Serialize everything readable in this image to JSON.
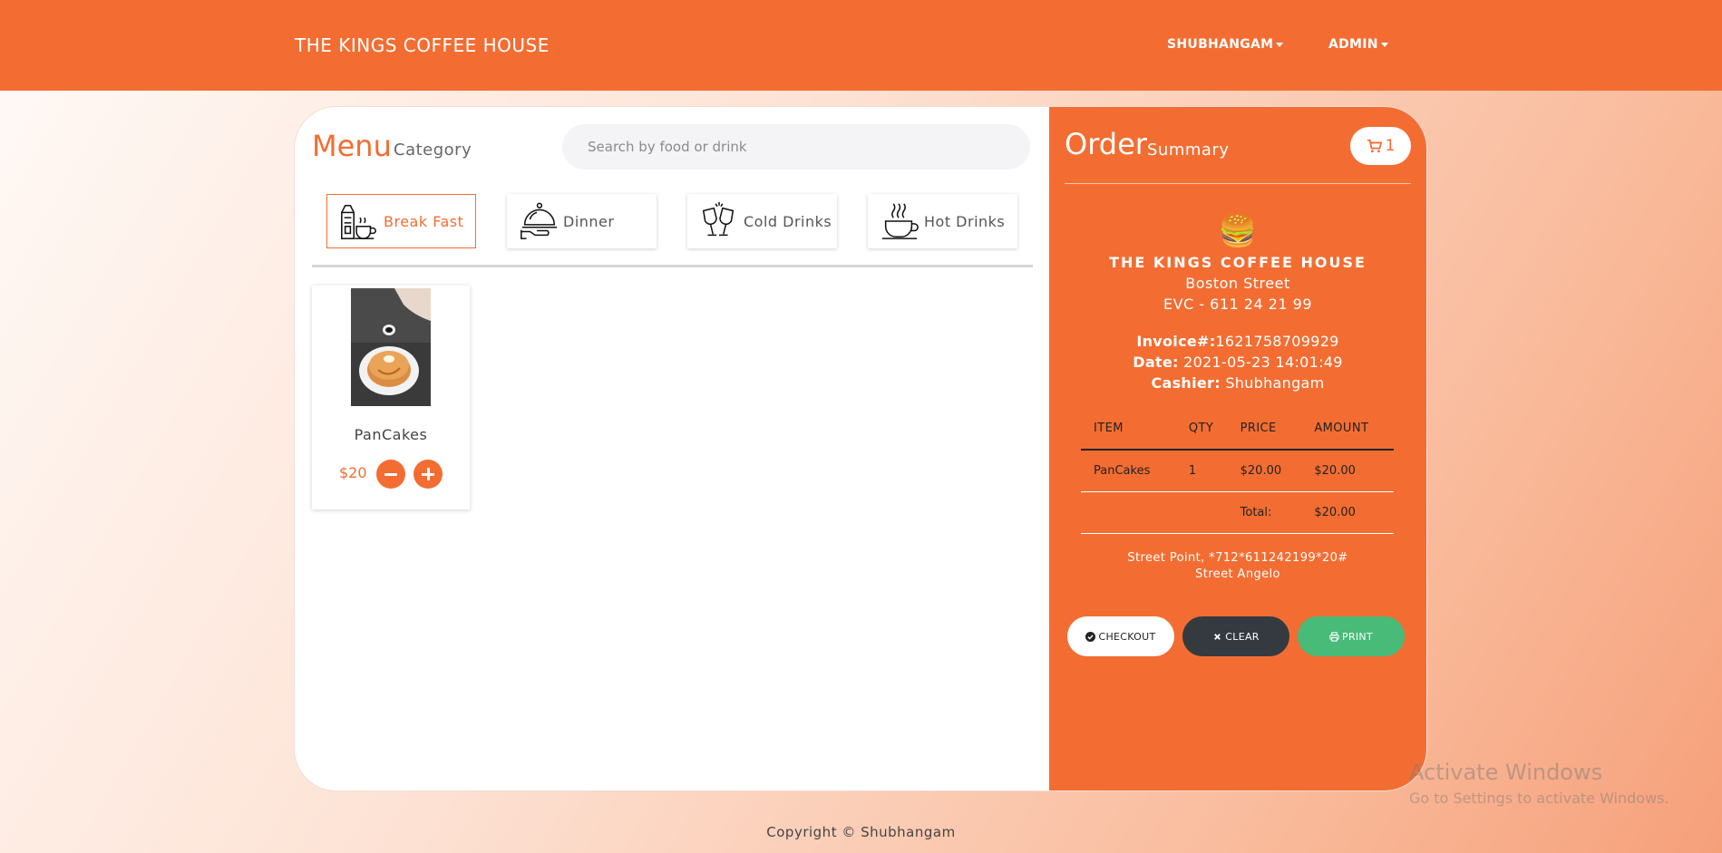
{
  "navbar": {
    "brand": "THE KINGS COFFEE HOUSE",
    "user_menu": "SHUBHANGAM",
    "admin_menu": "ADMIN"
  },
  "menu": {
    "title": "Menu",
    "subtitle": "Category",
    "search_placeholder": "Search by food or drink",
    "categories": [
      {
        "label": "Break Fast",
        "icon": "breakfast-icon",
        "active": true
      },
      {
        "label": "Dinner",
        "icon": "cloche-icon",
        "active": false
      },
      {
        "label": "Cold Drinks",
        "icon": "glasses-icon",
        "active": false
      },
      {
        "label": "Hot Drinks",
        "icon": "hot-cup-icon",
        "active": false
      }
    ],
    "items": [
      {
        "name": "PanCakes",
        "price": "$20"
      }
    ]
  },
  "order": {
    "title": "Order",
    "subtitle": "Summary",
    "cart_count": "1",
    "receipt": {
      "logo": "🍔",
      "shop_name": "THE KINGS COFFEE HOUSE",
      "street": "Boston Street",
      "phone": "EVC - 611 24 21 99",
      "invoice_label": "Invoice#:",
      "invoice_value": "1621758709929",
      "date_label": "Date:",
      "date_value": "2021-05-23 14:01:49",
      "cashier_label": "Cashier:",
      "cashier_value": "Shubhangam",
      "columns": [
        "ITEM",
        "QTY",
        "PRICE",
        "AMOUNT"
      ],
      "rows": [
        {
          "item": "PanCakes",
          "qty": "1",
          "price": "$20.00",
          "amount": "$20.00"
        }
      ],
      "total_label": "Total:",
      "total_value": "$20.00",
      "footer_line1": "Street Point, *712*611242199*20#",
      "footer_line2": "Street Angelo"
    },
    "actions": {
      "checkout": "CHECKOUT",
      "clear": "CLEAR",
      "print": "PRINT"
    }
  },
  "footer": {
    "copyright": "Copyright © Shubhangam"
  },
  "watermark": {
    "title": "Activate Windows",
    "subtitle": "Go to Settings to activate Windows."
  },
  "colors": {
    "accent": "#f36d32",
    "dark": "#343a40",
    "success": "#48bb78"
  }
}
